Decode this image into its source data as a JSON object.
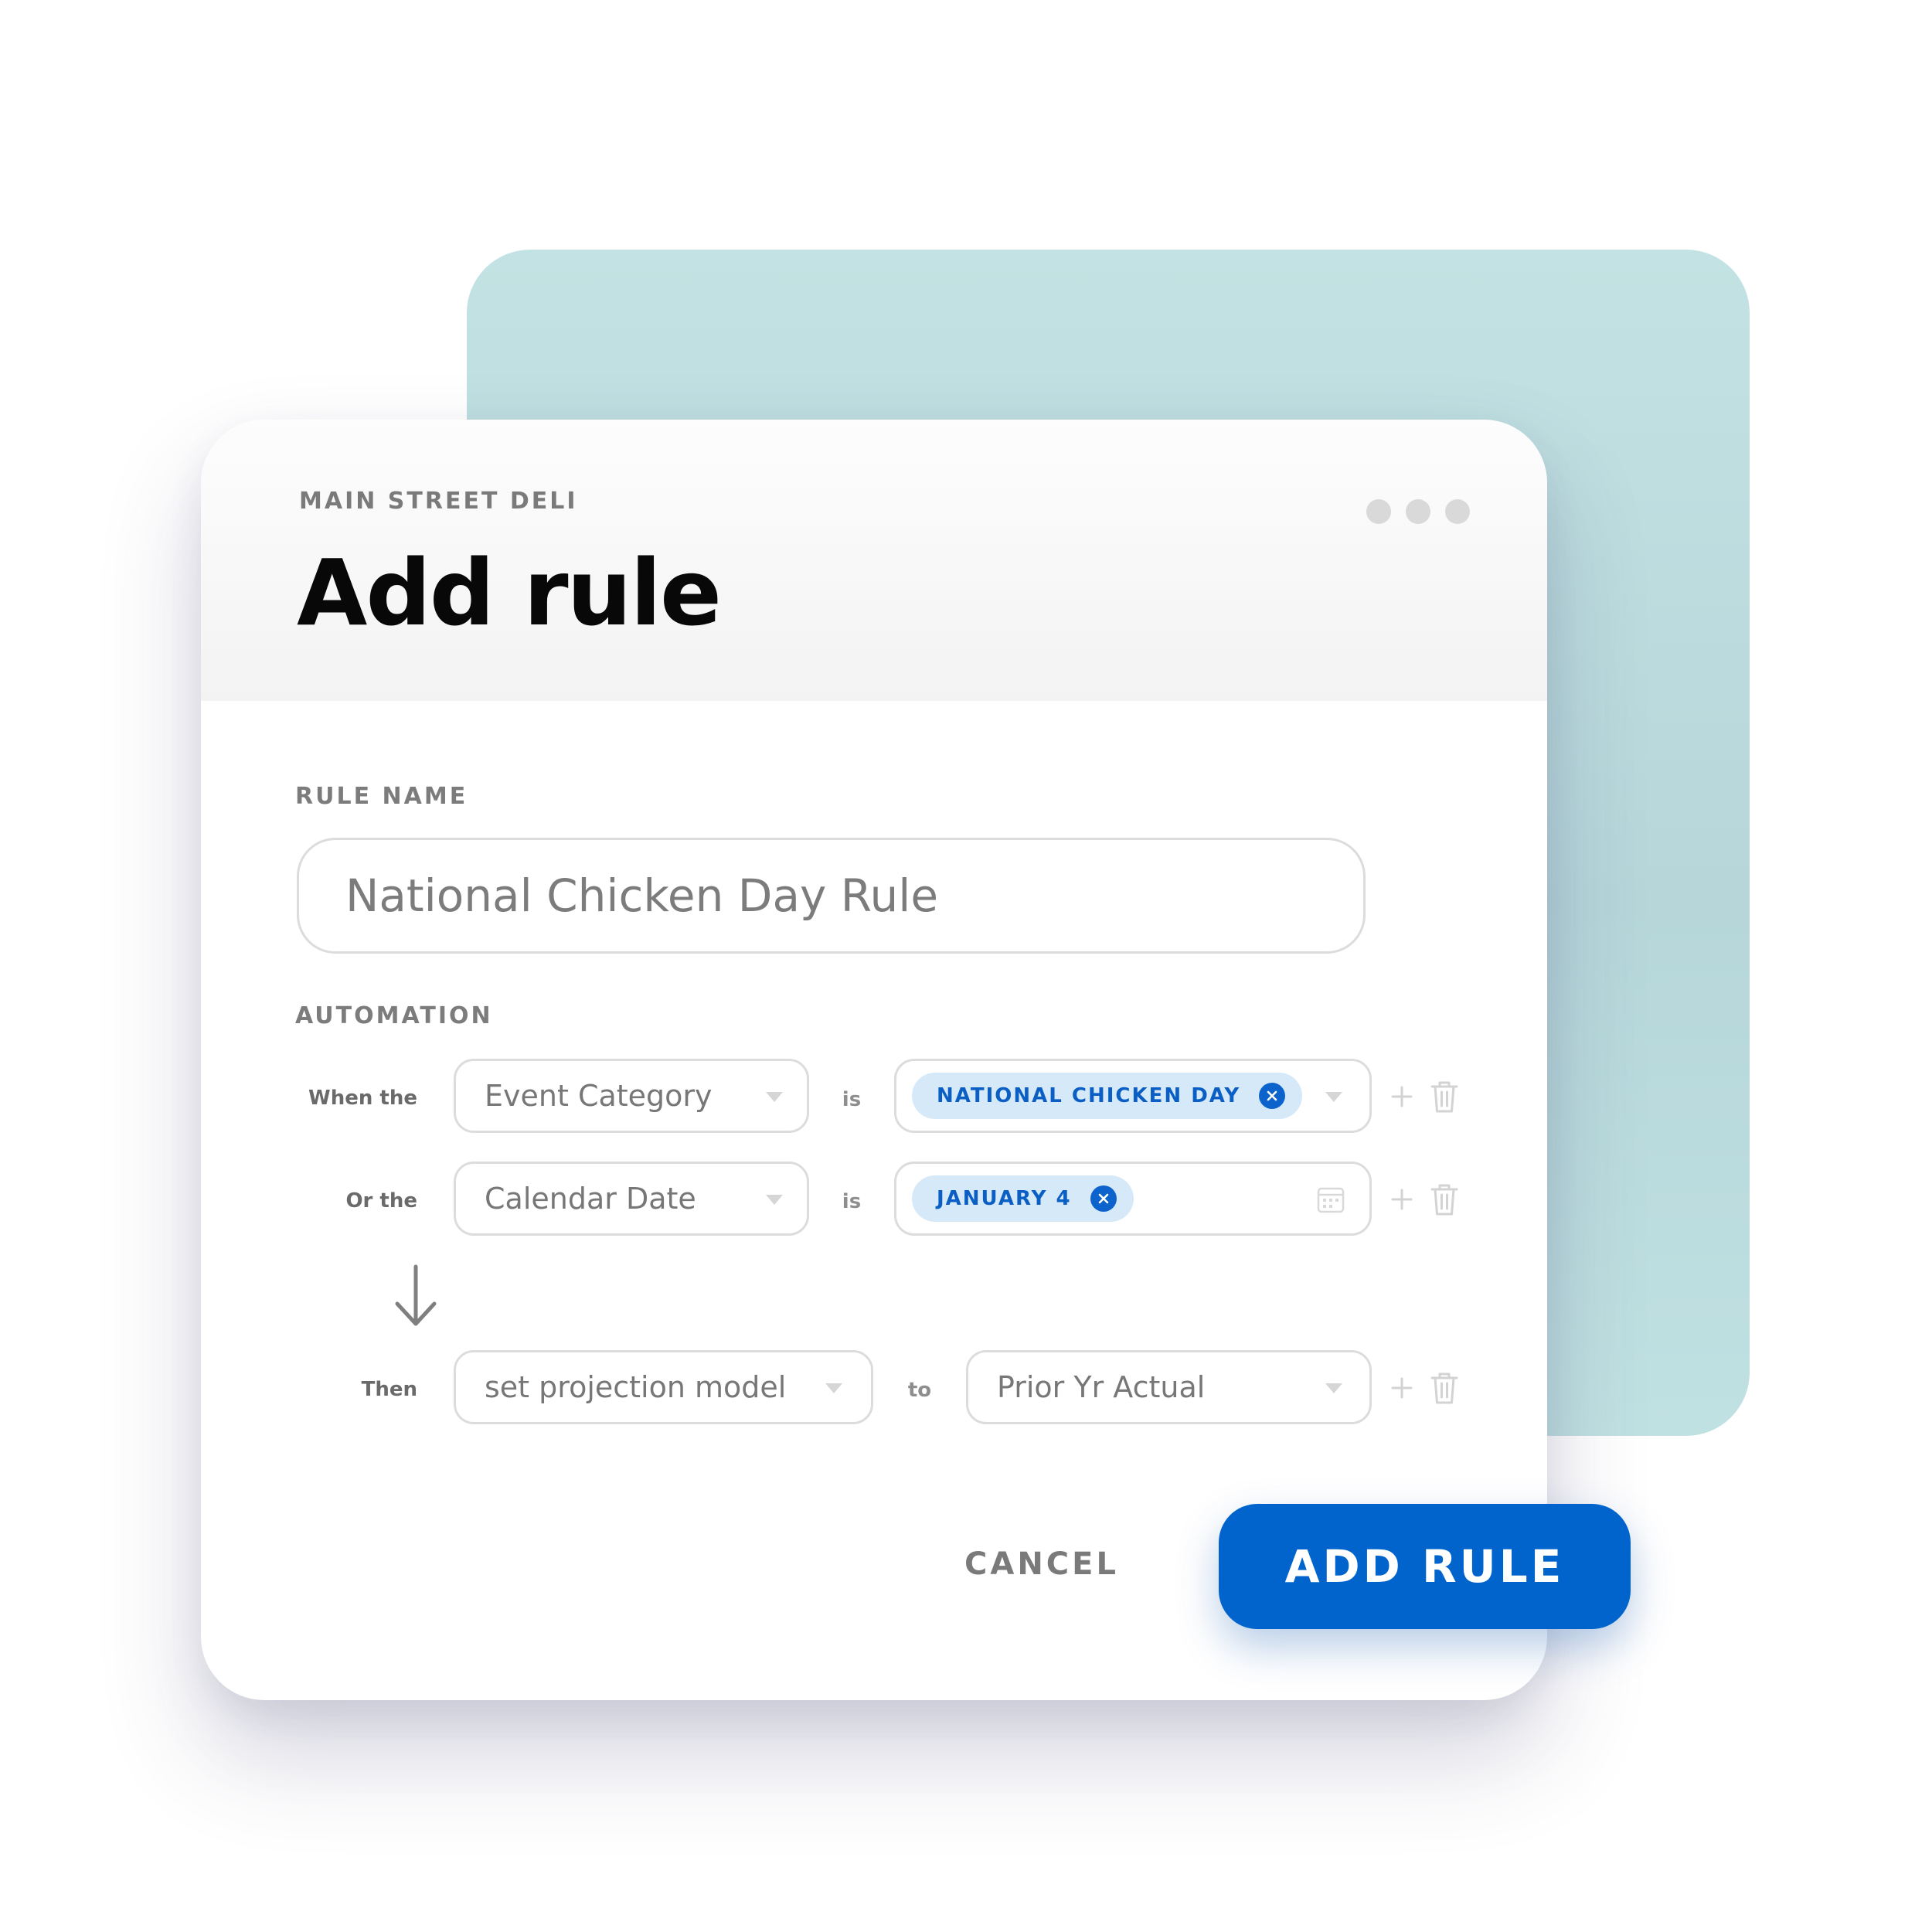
{
  "app": {
    "subtitle": "MAIN STREET DELI",
    "title": "Add rule"
  },
  "rule_name": {
    "label": "RULE NAME",
    "value": "National Chicken Day Rule"
  },
  "automation": {
    "label": "AUTOMATION",
    "conditions": [
      {
        "prefix": "When the",
        "field": "Event Category",
        "operator": "is",
        "value_tag": "NATIONAL CHICKEN DAY"
      },
      {
        "prefix": "Or the",
        "field": "Calendar Date",
        "operator": "is",
        "value_tag": "JANUARY 4"
      }
    ],
    "action": {
      "prefix": "Then",
      "field": "set projection model",
      "operator": "to",
      "value": "Prior Yr Actual"
    }
  },
  "footer": {
    "cancel_label": "CANCEL",
    "submit_label": "ADD RULE"
  },
  "colors": {
    "accent": "#0064CC",
    "tag_background": "#D5E9F9",
    "teal_backdrop": "#C2E2E3"
  },
  "icons": [
    "more-dots-icon",
    "chevron-down-icon",
    "remove-tag-icon",
    "calendar-icon",
    "plus-icon",
    "trash-icon",
    "arrow-down-icon"
  ]
}
